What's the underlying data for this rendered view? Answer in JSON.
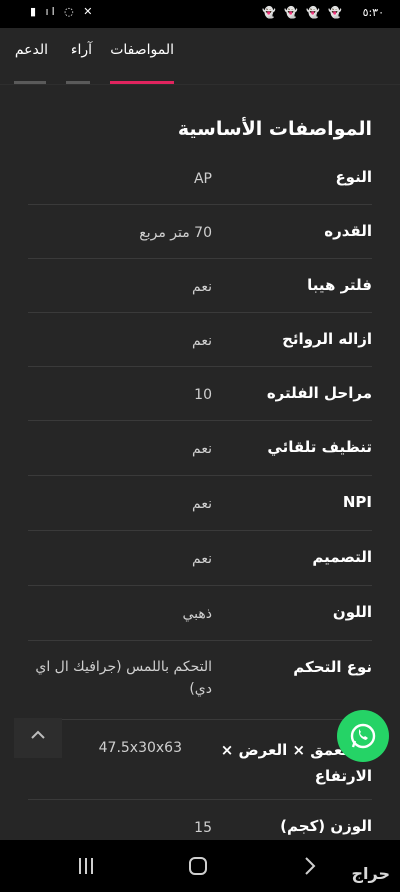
{
  "status_bar": {
    "time": "٥:٣٠",
    "left_icons": "▮ ıl ◌ ✕"
  },
  "tabs": [
    {
      "label": "المواصفات",
      "active": true
    },
    {
      "label": "آراء",
      "active": false
    },
    {
      "label": "الدعم",
      "active": false
    }
  ],
  "section_title": "المواصفات الأساسية",
  "specs": [
    {
      "label": "النوع",
      "value": "AP"
    },
    {
      "label": "القدره",
      "value": "70 متر مربع"
    },
    {
      "label": "فلتر هيبا",
      "value": "نعم"
    },
    {
      "label": "ازاله الروائح",
      "value": "نعم"
    },
    {
      "label": "مراحل الفلتره",
      "value": "10"
    },
    {
      "label": "تنظيف تلقائي",
      "value": "نعم"
    },
    {
      "label": "NPI",
      "value": "نعم"
    },
    {
      "label": "التصميم",
      "value": "نعم"
    },
    {
      "label": "اللون",
      "value": "ذهبي"
    },
    {
      "label": "نوع التحكم",
      "value": "التحكم باللمس (جرافيك ال اي دي)"
    },
    {
      "label": "د: العمق × العرض × الارتفاع",
      "value": "47.5x30x63"
    },
    {
      "label": "الوزن (كجم)",
      "value": "15"
    }
  ],
  "colors": {
    "accent": "#e0245e",
    "tab_inactive_underline": "#5a5a5a",
    "whatsapp": "#25d366"
  },
  "brand": "حراج"
}
